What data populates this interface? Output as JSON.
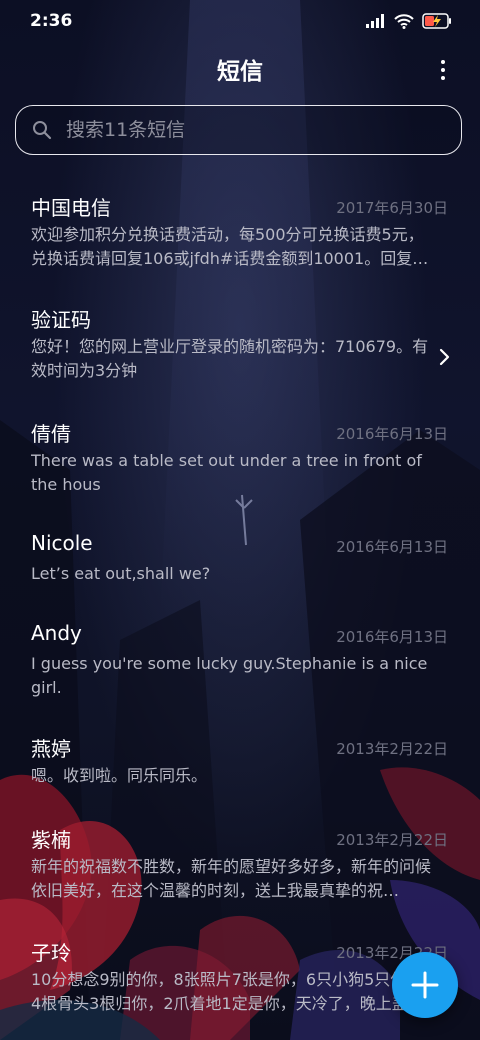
{
  "status_bar": {
    "time": "2:36",
    "icons": [
      "signal-icon",
      "wifi-icon",
      "battery-charging-icon"
    ],
    "battery_color": "#ff5a4a"
  },
  "header": {
    "title": "短信",
    "menu_icon": "more-vertical-icon"
  },
  "search": {
    "placeholder": "搜索11条短信",
    "value": "",
    "icon": "search-icon"
  },
  "messages": [
    {
      "name": "中国电信",
      "date": "2017年6月30日",
      "preview": "欢迎参加积分兑换话费活动，每500分可兑换话费5元，兑换话费请回复106或jfdh#话费金额到10001。回复…",
      "has_chevron": false
    },
    {
      "name": "验证码",
      "date": "",
      "preview": "您好！您的网上营业厅登录的随机密码为：710679。有效时间为3分钟",
      "has_chevron": true
    },
    {
      "name": "倩倩",
      "date": "2016年6月13日",
      "preview": "There was a table set out under a tree in front of the hous",
      "has_chevron": false
    },
    {
      "name": "Nicole",
      "date": "2016年6月13日",
      "preview": "Let’s eat out,shall we?",
      "has_chevron": false
    },
    {
      "name": "Andy",
      "date": "2016年6月13日",
      "preview": "I guess you're some lucky guy.Stephanie is a nice girl.",
      "has_chevron": false
    },
    {
      "name": "燕婷",
      "date": "2013年2月22日",
      "preview": "嗯。收到啦。同乐同乐。",
      "has_chevron": false
    },
    {
      "name": "紫楠",
      "date": "2013年2月22日",
      "preview": "新年的祝福数不胜数，新年的愿望好多好多，新年的问候依旧美好，在这个温馨的时刻，送上我最真挚的祝…",
      "has_chevron": false
    },
    {
      "name": "子玲",
      "date": "2013年2月22日",
      "preview": "10分想念9别的你，8张照片7张是你，6只小狗5只像你，4根骨头3根归你，2爪着地1定是你，天冷了，晚上盖",
      "has_chevron": false
    }
  ],
  "fab": {
    "icon": "plus-icon",
    "color": "#1aa0f0"
  },
  "colors": {
    "background": "#0f1327",
    "text_primary": "#ffffff",
    "text_secondary": "#b9bac6",
    "text_date": "#6f7182"
  }
}
